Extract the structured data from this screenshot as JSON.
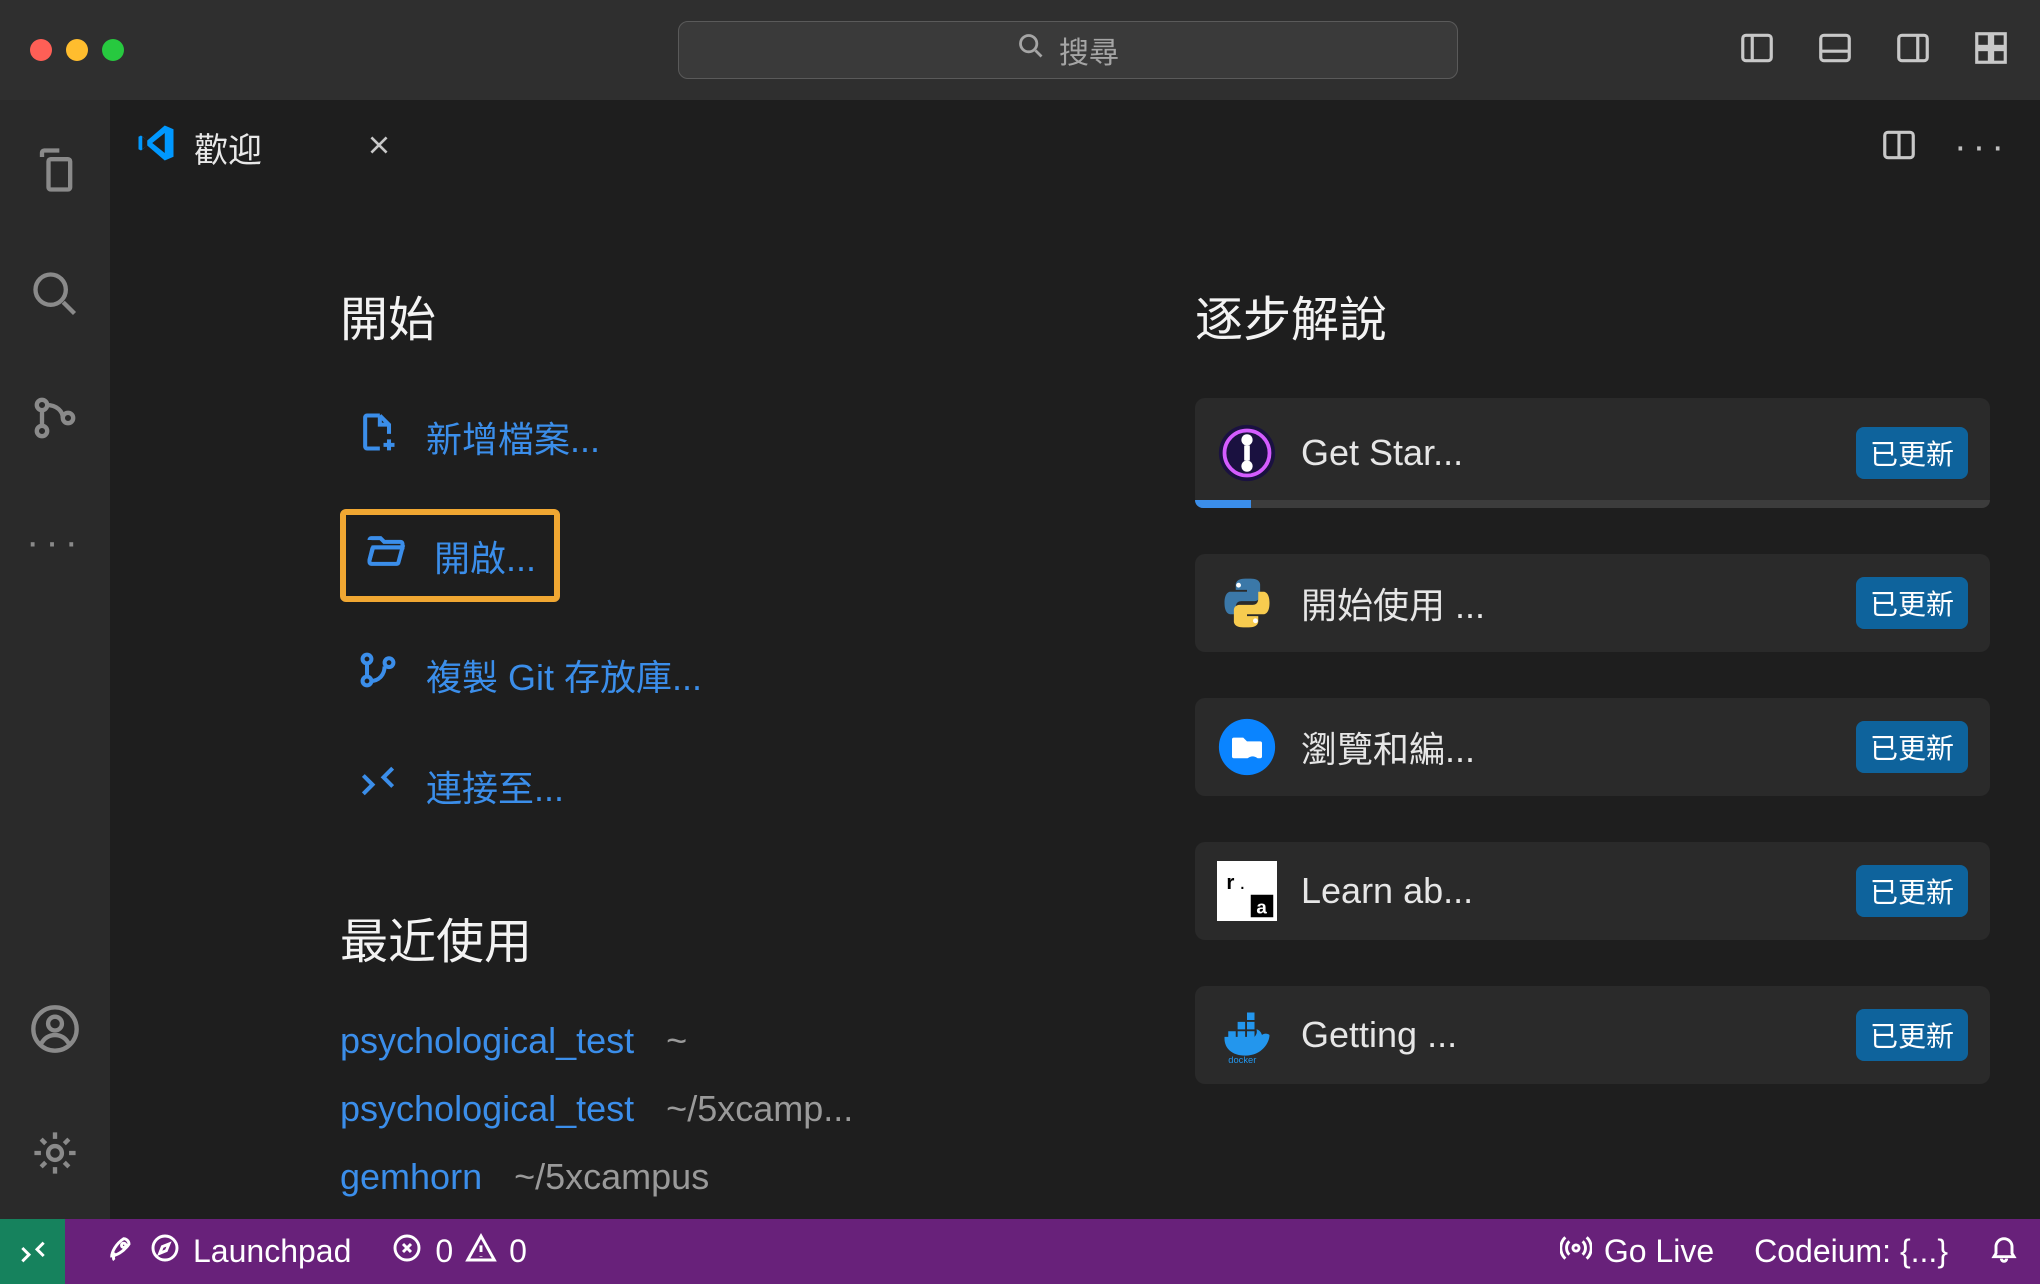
{
  "titleBar": {
    "searchPlaceholder": "搜尋"
  },
  "tab": {
    "title": "歡迎"
  },
  "welcome": {
    "startTitle": "開始",
    "startItems": [
      {
        "label": "新增檔案..."
      },
      {
        "label": "開啟..."
      },
      {
        "label": "複製 Git 存放庫..."
      },
      {
        "label": "連接至..."
      }
    ],
    "recentTitle": "最近使用",
    "recents": [
      {
        "name": "psychological_test",
        "path": "~"
      },
      {
        "name": "psychological_test",
        "path": "~/5xcamp..."
      },
      {
        "name": "gemhorn",
        "path": "~/5xcampus"
      }
    ],
    "walkTitle": "逐步解說",
    "cards": [
      {
        "label": "Get Star...",
        "badge": "已更新"
      },
      {
        "label": "開始使用 ...",
        "badge": "已更新"
      },
      {
        "label": "瀏覽和編...",
        "badge": "已更新"
      },
      {
        "label": "Learn ab...",
        "badge": "已更新"
      },
      {
        "label": "Getting ...",
        "badge": "已更新"
      }
    ]
  },
  "statusBar": {
    "launchpad": "Launchpad",
    "errors": "0",
    "warnings": "0",
    "goLive": "Go Live",
    "codeium": "Codeium: {...}"
  }
}
